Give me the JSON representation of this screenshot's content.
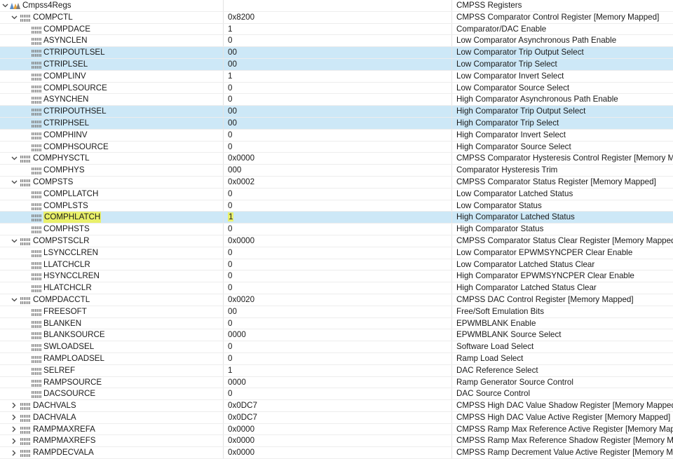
{
  "rows": [
    {
      "name": "Cmpss4Regs",
      "value": "",
      "desc": "CMPSS Registers",
      "level": 0,
      "kind": "root",
      "expander": "expanded"
    },
    {
      "name": "COMPCTL",
      "value": "0x8200",
      "desc": "CMPSS Comparator Control Register [Memory Mapped]",
      "level": 1,
      "kind": "reg",
      "expander": "expanded"
    },
    {
      "name": "COMPDACE",
      "value": "1",
      "desc": "Comparator/DAC Enable",
      "level": 2,
      "kind": "field"
    },
    {
      "name": "ASYNCLEN",
      "value": "0",
      "desc": "Low Comparator Asynchronous Path Enable",
      "level": 2,
      "kind": "field"
    },
    {
      "name": "CTRIPOUTLSEL",
      "value": "00",
      "desc": "Low Comparator Trip Output Select",
      "level": 2,
      "kind": "field",
      "selected": true
    },
    {
      "name": "CTRIPLSEL",
      "value": "00",
      "desc": "Low Comparator Trip Select",
      "level": 2,
      "kind": "field",
      "selected": true
    },
    {
      "name": "COMPLINV",
      "value": "1",
      "desc": "Low Comparator Invert Select",
      "level": 2,
      "kind": "field"
    },
    {
      "name": "COMPLSOURCE",
      "value": "0",
      "desc": "Low Comparator Source Select",
      "level": 2,
      "kind": "field"
    },
    {
      "name": "ASYNCHEN",
      "value": "0",
      "desc": "High Comparator Asynchronous Path Enable",
      "level": 2,
      "kind": "field"
    },
    {
      "name": "CTRIPOUTHSEL",
      "value": "00",
      "desc": "High Comparator Trip Output Select",
      "level": 2,
      "kind": "field",
      "selected": true
    },
    {
      "name": "CTRIPHSEL",
      "value": "00",
      "desc": "High Comparator Trip Select",
      "level": 2,
      "kind": "field",
      "selected": true
    },
    {
      "name": "COMPHINV",
      "value": "0",
      "desc": "High Comparator Invert Select",
      "level": 2,
      "kind": "field"
    },
    {
      "name": "COMPHSOURCE",
      "value": "0",
      "desc": "High Comparator Source Select",
      "level": 2,
      "kind": "field"
    },
    {
      "name": "COMPHYSCTL",
      "value": "0x0000",
      "desc": "CMPSS Comparator Hysteresis Control Register [Memory Map",
      "level": 1,
      "kind": "reg",
      "expander": "expanded"
    },
    {
      "name": "COMPHYS",
      "value": "000",
      "desc": "Comparator Hysteresis Trim",
      "level": 2,
      "kind": "field"
    },
    {
      "name": "COMPSTS",
      "value": "0x0002",
      "desc": "CMPSS Comparator Status Register [Memory Mapped]",
      "level": 1,
      "kind": "reg",
      "expander": "expanded"
    },
    {
      "name": "COMPLLATCH",
      "value": "0",
      "desc": "Low Comparator Latched Status",
      "level": 2,
      "kind": "field"
    },
    {
      "name": "COMPLSTS",
      "value": "0",
      "desc": "Low Comparator Status",
      "level": 2,
      "kind": "field"
    },
    {
      "name": "COMPHLATCH",
      "value": "1",
      "desc": "High Comparator Latched Status",
      "level": 2,
      "kind": "field",
      "selected": true,
      "highlight": true
    },
    {
      "name": "COMPHSTS",
      "value": "0",
      "desc": "High Comparator Status",
      "level": 2,
      "kind": "field"
    },
    {
      "name": "COMPSTSCLR",
      "value": "0x0000",
      "desc": "CMPSS Comparator Status Clear Register [Memory Mapped]",
      "level": 1,
      "kind": "reg",
      "expander": "expanded"
    },
    {
      "name": "LSYNCCLREN",
      "value": "0",
      "desc": "Low Comparator EPWMSYNCPER Clear Enable",
      "level": 2,
      "kind": "field"
    },
    {
      "name": "LLATCHCLR",
      "value": "0",
      "desc": "Low Comparator Latched Status Clear",
      "level": 2,
      "kind": "field"
    },
    {
      "name": "HSYNCCLREN",
      "value": "0",
      "desc": "High Comparator EPWMSYNCPER Clear Enable",
      "level": 2,
      "kind": "field"
    },
    {
      "name": "HLATCHCLR",
      "value": "0",
      "desc": "High Comparator Latched Status Clear",
      "level": 2,
      "kind": "field"
    },
    {
      "name": "COMPDACCTL",
      "value": "0x0020",
      "desc": "CMPSS DAC Control Register [Memory Mapped]",
      "level": 1,
      "kind": "reg",
      "expander": "expanded"
    },
    {
      "name": "FREESOFT",
      "value": "00",
      "desc": "Free/Soft Emulation Bits",
      "level": 2,
      "kind": "field"
    },
    {
      "name": "BLANKEN",
      "value": "0",
      "desc": "EPWMBLANK Enable",
      "level": 2,
      "kind": "field"
    },
    {
      "name": "BLANKSOURCE",
      "value": "0000",
      "desc": "EPWMBLANK Source Select",
      "level": 2,
      "kind": "field"
    },
    {
      "name": "SWLOADSEL",
      "value": "0",
      "desc": "Software Load Select",
      "level": 2,
      "kind": "field"
    },
    {
      "name": "RAMPLOADSEL",
      "value": "0",
      "desc": "Ramp Load Select",
      "level": 2,
      "kind": "field"
    },
    {
      "name": "SELREF",
      "value": "1",
      "desc": "DAC Reference Select",
      "level": 2,
      "kind": "field"
    },
    {
      "name": "RAMPSOURCE",
      "value": "0000",
      "desc": "Ramp Generator Source Control",
      "level": 2,
      "kind": "field"
    },
    {
      "name": "DACSOURCE",
      "value": "0",
      "desc": "DAC Source Control",
      "level": 2,
      "kind": "field"
    },
    {
      "name": "DACHVALS",
      "value": "0x0DC7",
      "desc": "CMPSS High DAC Value Shadow Register [Memory Mapped]",
      "level": 1,
      "kind": "reg",
      "expander": "collapsed"
    },
    {
      "name": "DACHVALA",
      "value": "0x0DC7",
      "desc": "CMPSS High DAC Value Active Register [Memory Mapped]",
      "level": 1,
      "kind": "reg",
      "expander": "collapsed"
    },
    {
      "name": "RAMPMAXREFA",
      "value": "0x0000",
      "desc": "CMPSS Ramp Max Reference Active Register [Memory Mapped",
      "level": 1,
      "kind": "reg",
      "expander": "collapsed"
    },
    {
      "name": "RAMPMAXREFS",
      "value": "0x0000",
      "desc": "CMPSS Ramp Max Reference Shadow Register [Memory Map",
      "level": 1,
      "kind": "reg",
      "expander": "collapsed"
    },
    {
      "name": "RAMPDECVALA",
      "value": "0x0000",
      "desc": "CMPSS Ramp Decrement Value Active Register [Memory Mappe",
      "level": 1,
      "kind": "reg",
      "expander": "collapsed"
    }
  ],
  "icons": {
    "expanded": "chevron-down-icon",
    "collapsed": "chevron-right-icon",
    "register": "register-icon",
    "root": "register-group-icon"
  },
  "colors": {
    "selection": "#cde8f7",
    "highlight": "#e9f06a"
  }
}
